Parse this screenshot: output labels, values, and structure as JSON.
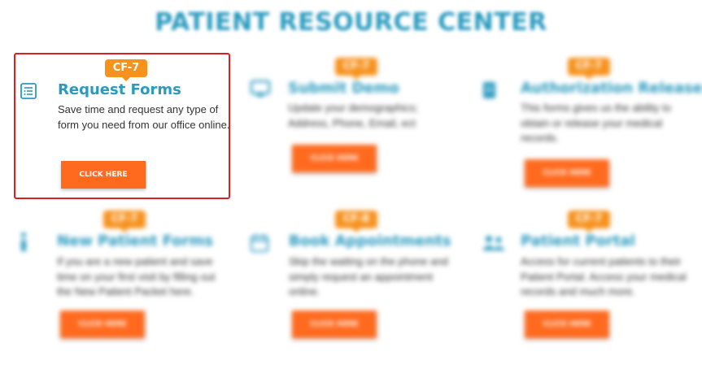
{
  "page_title": "PATIENT RESOURCE CENTER",
  "colors": {
    "brand": "#2a9bbf",
    "badge": "#f6921e",
    "button": "#ff6a1f",
    "selection_border": "#d62222"
  },
  "cards": [
    {
      "badge": "CF-7",
      "icon": "form-list-icon",
      "title": "Request Forms",
      "description": "Save time and request any type of form you need from our office online.",
      "button": "CLICK HERE",
      "selected": true
    },
    {
      "badge": "CF-7",
      "icon": "monitor-icon",
      "title": "Submit Demo",
      "description": "Update your demographics; Address, Phone, Email, ect",
      "button": "CLICK HERE"
    },
    {
      "badge": "CF-7",
      "icon": "document-icon",
      "title": "Authorization Release",
      "description": "This forms gives us the ability to obtain or release your medical records.",
      "button": "CLICK HERE"
    },
    {
      "badge": "CF-7",
      "icon": "info-icon",
      "title": "New Patient Forms",
      "description": "If you are a new patient and save time on your first visit by filling out the New Patient Packet here.",
      "button": "CLICK HERE"
    },
    {
      "badge": "CF-8",
      "icon": "calendar-icon",
      "title": "Book Appointments",
      "description": "Skip the waiting on the phone and simply request an appointment online.",
      "button": "CLICK HERE"
    },
    {
      "badge": "CF-7",
      "icon": "users-icon",
      "title": "Patient Portal",
      "description": "Access for current patients to their Patient Portal. Access your medical records and much more.",
      "button": "CLICK HERE"
    }
  ]
}
